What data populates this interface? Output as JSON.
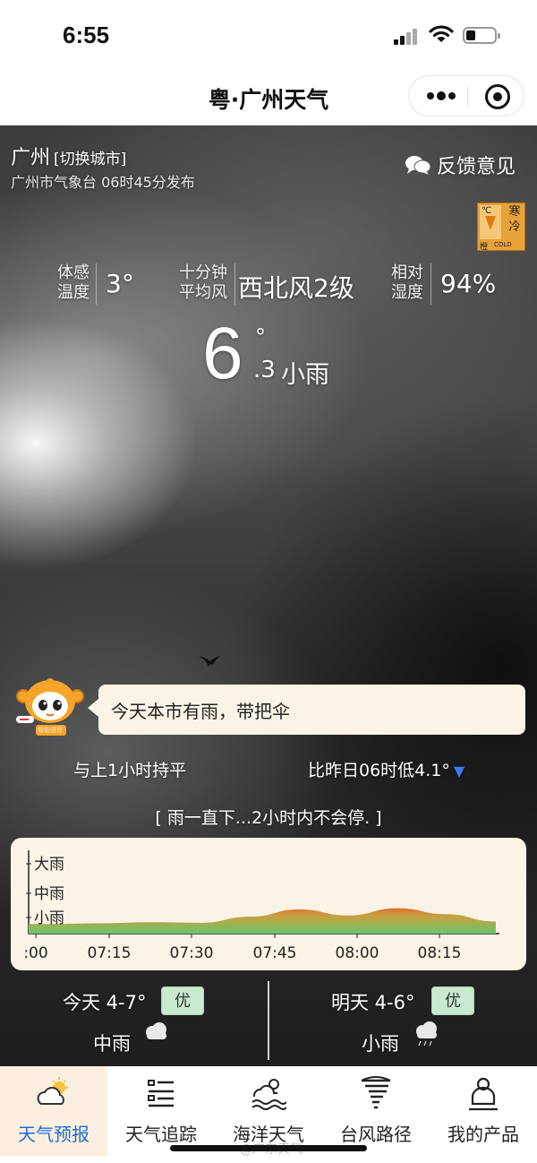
{
  "status_bar": {
    "time": "6:55"
  },
  "title_bar": {
    "title": "粤·广州天气"
  },
  "header": {
    "city": "广州",
    "switch_city": "[切换城市]",
    "issuer": "广州市气象台 06时45分发布",
    "feedback": "反馈意见"
  },
  "warning_badge": {
    "zh": "寒冷",
    "orange": "橙",
    "en": "COLD",
    "unit": "℃"
  },
  "metrics": {
    "feels_label_1": "体感",
    "feels_label_2": "温度",
    "feels_value": "3°",
    "wind_label_1": "十分钟",
    "wind_label_2": "平均风",
    "wind_value": "西北风2级",
    "humidity_label_1": "相对",
    "humidity_label_2": "湿度",
    "humidity_value": "94%"
  },
  "current": {
    "temp_int": "6",
    "deg": "°",
    "temp_dec": ".3",
    "desc": "小雨"
  },
  "assistant": {
    "robot_caption": "智能语音",
    "tip": "今天本市有雨，带把伞"
  },
  "trend": {
    "hour_compare": "与上1小时持平",
    "yesterday_compare": "比昨日06时低4.1°",
    "arrow": "▼",
    "rain_message": "[ 雨一直下...2小时内不会停. ]"
  },
  "chart_data": {
    "type": "area",
    "y_levels": [
      "小雨",
      "中雨",
      "大雨"
    ],
    "x_ticks": [
      ":00",
      "07:15",
      "07:30",
      "07:45",
      "08:00",
      "08:15"
    ],
    "x": [
      "06:55",
      "07:00",
      "07:10",
      "07:20",
      "07:30",
      "07:40",
      "07:50",
      "08:00",
      "08:10",
      "08:20",
      "08:30"
    ],
    "values": [
      1.0,
      1.0,
      1.03,
      1.07,
      1.05,
      1.3,
      1.6,
      1.35,
      1.65,
      1.4,
      1.1
    ],
    "colors": {
      "low": "#6cc46a",
      "high": "#d9722f"
    }
  },
  "forecast": {
    "today_label": "今天 4-7°",
    "today_aqi": "优",
    "today_cond": "中雨",
    "tomorrow_label": "明天 4-6°",
    "tomorrow_aqi": "优",
    "tomorrow_cond": "小雨"
  },
  "tabs": [
    {
      "label": "天气预报",
      "icon": "cloud-sun-icon",
      "active": true
    },
    {
      "label": "天气追踪",
      "icon": "list-icon",
      "active": false
    },
    {
      "label": "海洋天气",
      "icon": "ocean-icon",
      "active": false
    },
    {
      "label": "台风路径",
      "icon": "typhoon-icon",
      "active": false
    },
    {
      "label": "我的产品",
      "icon": "user-icon",
      "active": false
    }
  ],
  "watermark": "@广东天气"
}
